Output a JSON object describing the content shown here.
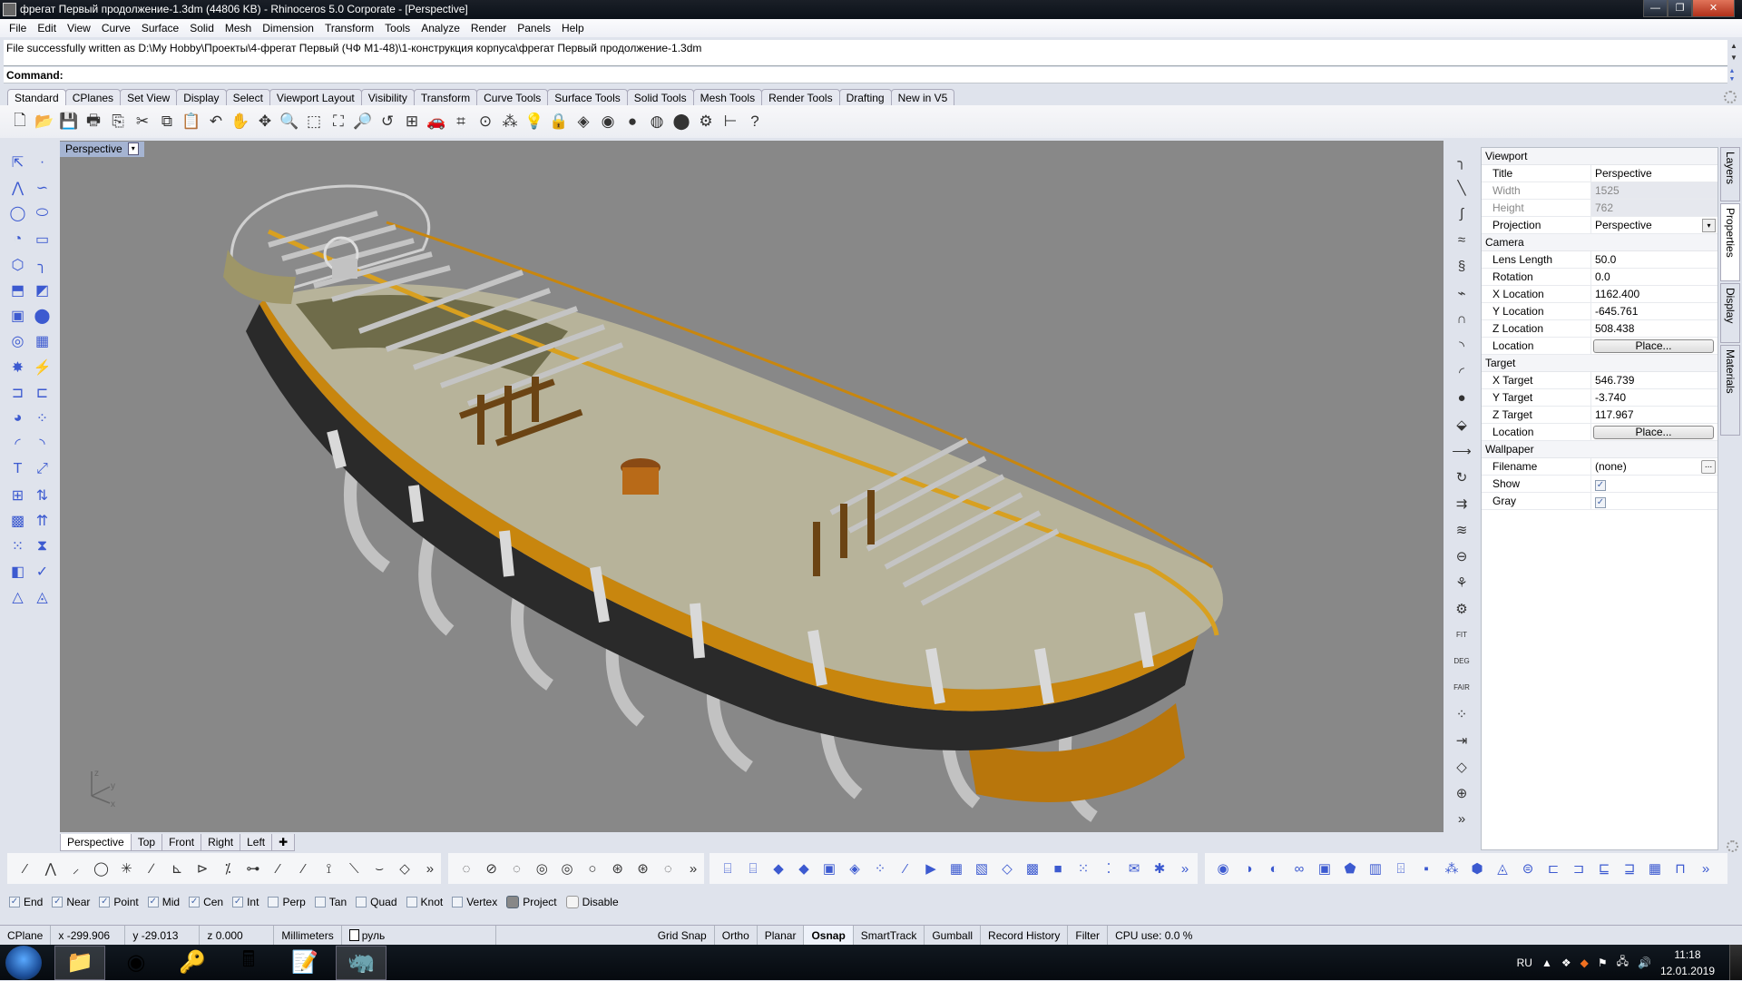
{
  "window": {
    "title": "фрегат Первый продолжение-1.3dm (44806 KB) - Rhinoceros  5.0 Corporate - [Perspective]",
    "minimize": "—",
    "restore": "❐",
    "close": "✕"
  },
  "menu": [
    "File",
    "Edit",
    "View",
    "Curve",
    "Surface",
    "Solid",
    "Mesh",
    "Dimension",
    "Transform",
    "Tools",
    "Analyze",
    "Render",
    "Panels",
    "Help"
  ],
  "history": {
    "line": "File successfully written as D:\\My Hobby\\Проекты\\4-фрегат Первый (ЧФ М1-48)\\1-конструкция корпуса\\фрегат Первый продолжение-1.3dm"
  },
  "command": {
    "label": "Command:",
    "value": ""
  },
  "toolbar_tabs": [
    "Standard",
    "CPlanes",
    "Set View",
    "Display",
    "Select",
    "Viewport Layout",
    "Visibility",
    "Transform",
    "Curve Tools",
    "Surface Tools",
    "Solid Tools",
    "Mesh Tools",
    "Render Tools",
    "Drafting",
    "New in V5"
  ],
  "toolbar_tabs_active": "Standard",
  "standard_icons": [
    {
      "name": "new-icon",
      "glyph": "🗋"
    },
    {
      "name": "open-icon",
      "glyph": "📂"
    },
    {
      "name": "save-icon",
      "glyph": "💾"
    },
    {
      "name": "print-icon",
      "glyph": "🖶"
    },
    {
      "name": "export-icon",
      "glyph": "⎘"
    },
    {
      "name": "cut-icon",
      "glyph": "✂"
    },
    {
      "name": "copy-icon",
      "glyph": "⧉"
    },
    {
      "name": "paste-icon",
      "glyph": "📋"
    },
    {
      "name": "undo-icon",
      "glyph": "↶"
    },
    {
      "name": "pan-icon",
      "glyph": "✋"
    },
    {
      "name": "rotate-view-icon",
      "glyph": "✥"
    },
    {
      "name": "zoom-dynamic-icon",
      "glyph": "🔍"
    },
    {
      "name": "zoom-window-icon",
      "glyph": "⬚"
    },
    {
      "name": "zoom-extents-icon",
      "glyph": "⛶"
    },
    {
      "name": "zoom-selected-icon",
      "glyph": "🔎"
    },
    {
      "name": "undo-view-icon",
      "glyph": "↺"
    },
    {
      "name": "four-viewports-icon",
      "glyph": "⊞"
    },
    {
      "name": "car-icon",
      "glyph": "🚗"
    },
    {
      "name": "grid-options-icon",
      "glyph": "⌗"
    },
    {
      "name": "cplane-icon",
      "glyph": "⊙"
    },
    {
      "name": "select-points-icon",
      "glyph": "⁂"
    },
    {
      "name": "light-icon",
      "glyph": "💡"
    },
    {
      "name": "lock-icon",
      "glyph": "🔒"
    },
    {
      "name": "layers-icon",
      "glyph": "◈"
    },
    {
      "name": "color-wheel-icon",
      "glyph": "◉"
    },
    {
      "name": "shaded-icon",
      "glyph": "●"
    },
    {
      "name": "rendered-icon",
      "glyph": "◍"
    },
    {
      "name": "render-icon",
      "glyph": "⬤"
    },
    {
      "name": "options-icon",
      "glyph": "⚙"
    },
    {
      "name": "dimension-icon",
      "glyph": "⊢"
    },
    {
      "name": "help-icon",
      "glyph": "?"
    }
  ],
  "viewport": {
    "title": "Perspective",
    "dropdown": "▾",
    "axes": {
      "z": "z",
      "y": "y",
      "x": "x"
    }
  },
  "left_tools": [
    "select-arrow-icon",
    "point-icon",
    "polyline-icon",
    "curve-icon",
    "circle-icon",
    "ellipse-icon",
    "arc-icon",
    "rectangle-icon",
    "polygon-icon",
    "fillet-curve-icon",
    "surface-corner-icon",
    "surface-edge-icon",
    "box-icon",
    "sphere-icon",
    "extrude-icon",
    "surface-patch-icon",
    "explode-icon",
    "boolean-split-icon",
    "trim-icon",
    "split-icon",
    "boolean-icon",
    "group-icon",
    "fillet-icon",
    "offset-icon",
    "text-icon",
    "move-icon",
    "array-icon",
    "mirror-icon",
    "cage-edit-icon",
    "project-icon",
    "grid-array-icon",
    "split-pipe-icon",
    "analyze-icon",
    "check-icon",
    "solid-primitives-icon",
    "render-shape-icon"
  ],
  "left_tool_glyphs": [
    "⇱",
    "·",
    "⋀",
    "∽",
    "◯",
    "⬭",
    "◔",
    "▭",
    "⬡",
    "╮",
    "⬒",
    "◩",
    "▣",
    "⬤",
    "◎",
    "▦",
    "✸",
    "⚡",
    "⊐",
    "⊏",
    "◕",
    "⁘",
    "◜",
    "◝",
    "T",
    "⤢",
    "⊞",
    "⇅",
    "▩",
    "⇈",
    "⁙",
    "⧗",
    "◧",
    "✓",
    "△",
    "◬"
  ],
  "right_tools": [
    "fillet-curve-icon",
    "chamfer-curve-icon",
    "blend-curve-icon",
    "match-curve-icon",
    "offset-curve-icon",
    "adjust-seam-icon",
    "arc-blend-icon",
    "fillet-corners-icon",
    "connect-icon",
    "gumball-icon",
    "flatten-icon",
    "extend-icon",
    "rebuild-icon",
    "change-degree-icon",
    "flow-icon",
    "pipe-icon",
    "fair-icon",
    "smooth-icon",
    "fit-icon",
    "deg-icon",
    "fair-label-icon",
    "points-on-icon",
    "insert-knot-icon",
    "polygon-icon",
    "cage-icon",
    "more-icon"
  ],
  "right_tool_glyphs": [
    "╮",
    "╲",
    "∫",
    "≈",
    "§",
    "⌁",
    "∩",
    "◝",
    "◜",
    "●",
    "⬙",
    "⟶",
    "↻",
    "⇉",
    "≋",
    "⊖",
    "⚘",
    "⚙",
    "FIT",
    "DEG",
    "FAIR",
    "⁘",
    "⇥",
    "◇",
    "⊕",
    "»"
  ],
  "properties": {
    "sections": [
      {
        "title": "Viewport",
        "rows": [
          {
            "key": "Title",
            "value": "Perspective",
            "type": "text"
          },
          {
            "key": "Width",
            "value": "1525",
            "type": "disabled"
          },
          {
            "key": "Height",
            "value": "762",
            "type": "disabled"
          },
          {
            "key": "Projection",
            "value": "Perspective",
            "type": "dropdown"
          }
        ]
      },
      {
        "title": "Camera",
        "rows": [
          {
            "key": "Lens Length",
            "value": "50.0",
            "type": "text"
          },
          {
            "key": "Rotation",
            "value": "0.0",
            "type": "text"
          },
          {
            "key": "X Location",
            "value": "1162.400",
            "type": "text"
          },
          {
            "key": "Y Location",
            "value": "-645.761",
            "type": "text"
          },
          {
            "key": "Z Location",
            "value": "508.438",
            "type": "text"
          },
          {
            "key": "Location",
            "value": "Place...",
            "type": "button"
          }
        ]
      },
      {
        "title": "Target",
        "rows": [
          {
            "key": "X Target",
            "value": "546.739",
            "type": "text"
          },
          {
            "key": "Y Target",
            "value": "-3.740",
            "type": "text"
          },
          {
            "key": "Z Target",
            "value": "117.967",
            "type": "text"
          },
          {
            "key": "Location",
            "value": "Place...",
            "type": "button"
          }
        ]
      },
      {
        "title": "Wallpaper",
        "rows": [
          {
            "key": "Filename",
            "value": "(none)",
            "type": "file"
          },
          {
            "key": "Show",
            "value": true,
            "type": "checkbox"
          },
          {
            "key": "Gray",
            "value": true,
            "type": "checkbox"
          }
        ]
      }
    ],
    "dropdown_glyph": "▾",
    "file_button": "...",
    "check_glyph": "✓"
  },
  "side_tabs": [
    {
      "label": "Layers",
      "active": false
    },
    {
      "label": "Properties",
      "active": true
    },
    {
      "label": "Display",
      "active": false
    },
    {
      "label": "Materials",
      "active": false
    }
  ],
  "viewport_tabs": [
    "Perspective",
    "Top",
    "Front",
    "Right",
    "Left"
  ],
  "viewport_tabs_active": "Perspective",
  "viewport_tab_add": "✚",
  "bottom_toolbars": {
    "curve": [
      "⁄",
      "⋀",
      "⸝",
      "◯",
      "✳",
      "∕",
      "⊾",
      "⊳",
      "⁒",
      "⊶",
      "⁄",
      "⁄",
      "⟟",
      "⟍",
      "⌣",
      "◇",
      "»"
    ],
    "circle": [
      "◌",
      "⊘",
      "◌",
      "◎",
      "◎",
      "○",
      "⊛",
      "⊛",
      "◌",
      "»"
    ],
    "surface": [
      "⌸",
      "⌸",
      "◆",
      "◆",
      "▣",
      "◈",
      "⁘",
      "⁄",
      "▶",
      "▦",
      "▧",
      "◇",
      "▩",
      "■",
      "⁙",
      "⁚",
      "✉",
      "✱",
      "»"
    ],
    "solid": [
      "◉",
      "◑",
      "◐",
      "∞",
      "▣",
      "⬟",
      "▥",
      "⌹",
      "▪",
      "⁂",
      "⬢",
      "◬",
      "⊜",
      "⊏",
      "⊐",
      "⊑",
      "⊒",
      "▦",
      "⊓",
      "»"
    ]
  },
  "osnaps": [
    {
      "label": "End",
      "checked": true
    },
    {
      "label": "Near",
      "checked": true
    },
    {
      "label": "Point",
      "checked": true
    },
    {
      "label": "Mid",
      "checked": true
    },
    {
      "label": "Cen",
      "checked": true
    },
    {
      "label": "Int",
      "checked": true
    },
    {
      "label": "Perp",
      "checked": false
    },
    {
      "label": "Tan",
      "checked": false
    },
    {
      "label": "Quad",
      "checked": false
    },
    {
      "label": "Knot",
      "checked": false
    },
    {
      "label": "Vertex",
      "checked": false
    }
  ],
  "osnap_toggles": [
    {
      "label": "Project",
      "on": true
    },
    {
      "label": "Disable",
      "on": false
    }
  ],
  "status": {
    "cplane": "CPlane",
    "x": "x -299.906",
    "y": "y -29.013",
    "z": "z 0.000",
    "units": "Millimeters",
    "layer": "руль",
    "toggles": [
      {
        "label": "Grid Snap",
        "on": false
      },
      {
        "label": "Ortho",
        "on": false
      },
      {
        "label": "Planar",
        "on": false
      },
      {
        "label": "Osnap",
        "on": true
      },
      {
        "label": "SmartTrack",
        "on": false
      },
      {
        "label": "Gumball",
        "on": false
      },
      {
        "label": "Record History",
        "on": false
      },
      {
        "label": "Filter",
        "on": false
      }
    ],
    "cpu": "CPU use: 0.0 %"
  },
  "taskbar": {
    "apps": [
      {
        "name": "explorer",
        "glyph": "📁",
        "active": true
      },
      {
        "name": "chrome",
        "glyph": "◉",
        "active": false
      },
      {
        "name": "keys",
        "glyph": "🔑",
        "active": false
      },
      {
        "name": "calculator",
        "glyph": "🖩",
        "active": false
      },
      {
        "name": "notepad",
        "glyph": "📝",
        "active": false
      },
      {
        "name": "rhinoceros",
        "glyph": "🦏",
        "active": true
      }
    ],
    "lang": "RU",
    "time": "11:18",
    "date": "12.01.2019"
  },
  "colors": {
    "viewport_bg": "#888888",
    "deck": "#b7b39a",
    "hull_black": "#2a2a2a",
    "frames": "#d6d6d6",
    "wood": "#c8860e",
    "dark_wood": "#6b4414"
  }
}
